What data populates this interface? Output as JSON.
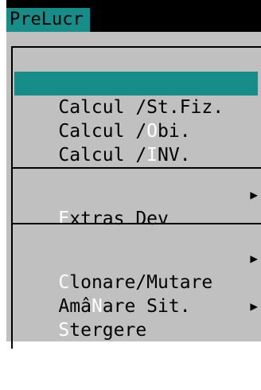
{
  "menu_bar": {
    "title": "PreLucr"
  },
  "menu": {
    "items": [
      {
        "pre": "Calcul /",
        "hot": "",
        "post": "St.Fiz.",
        "selected": true,
        "submenu": false
      },
      {
        "pre": "Calcul /",
        "hot": "O",
        "post": "bi.",
        "selected": false,
        "submenu": false
      },
      {
        "pre": "Calcul /",
        "hot": "I",
        "post": "NV.",
        "selected": false,
        "submenu": false
      },
      {
        "pre": "",
        "hot": "E",
        "post": "xtras Dev",
        "selected": false,
        "submenu": true
      },
      {
        "pre": "",
        "hot": "C",
        "post": "lonare/Mutare",
        "selected": false,
        "submenu": true
      },
      {
        "pre": "Amâ",
        "hot": "N",
        "post": "are Sit.",
        "selected": false,
        "submenu": false
      },
      {
        "pre": "",
        "hot": "S",
        "post": "tergere",
        "selected": false,
        "submenu": true
      }
    ],
    "submenu_arrow": "▶"
  },
  "colors": {
    "accent": "#178d8a",
    "menu_background": "#c0c0c0",
    "hotkey": "#ffffff",
    "text": "#000000"
  }
}
